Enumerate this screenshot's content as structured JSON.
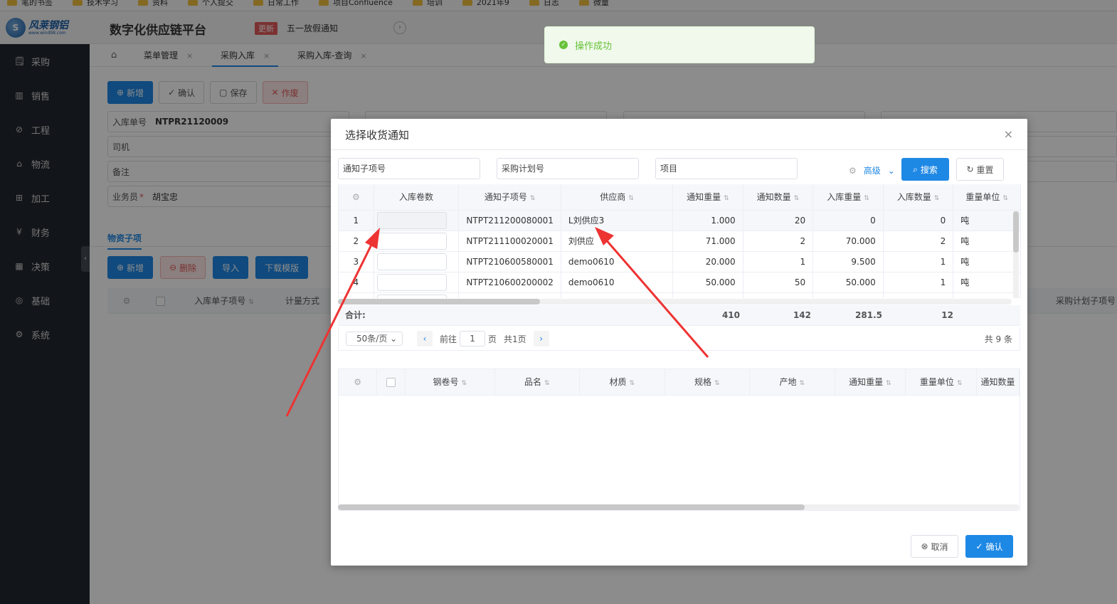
{
  "bookmarks": [
    "笔的书签",
    "技术学习",
    "资料",
    "个人提交",
    "日常工作",
    "项目Confluence",
    "培训",
    "2021年9",
    "日志",
    "",
    "微量"
  ],
  "app": {
    "title": "数字化供应链平台",
    "logo_name": "风莱钢铝",
    "logo_url": "www.wind98.com",
    "update_badge": "更新",
    "notice": "五一放假通知",
    "notice_arrow": "›"
  },
  "sidebar": {
    "items": [
      {
        "label": "采购",
        "icon": "🗒"
      },
      {
        "label": "销售",
        "icon": "▥"
      },
      {
        "label": "工程",
        "icon": "⊘"
      },
      {
        "label": "物流",
        "icon": "⌂"
      },
      {
        "label": "加工",
        "icon": "⊞"
      },
      {
        "label": "财务",
        "icon": "¥"
      },
      {
        "label": "决策",
        "icon": "▦"
      },
      {
        "label": "基础",
        "icon": "◎"
      },
      {
        "label": "系统",
        "icon": "⚙"
      }
    ],
    "collapse": "‹"
  },
  "tabs": {
    "home_icon": "⌂",
    "items": [
      {
        "label": "菜单管理",
        "close": "×"
      },
      {
        "label": "采购入库",
        "close": "×"
      },
      {
        "label": "采购入库-查询",
        "close": "×"
      }
    ]
  },
  "toolbar": {
    "new": "新增",
    "new_icon": "⊕",
    "confirm": "确认",
    "confirm_icon": "✓",
    "save": "保存",
    "save_icon": "▢",
    "void": "作废",
    "void_icon": "✕"
  },
  "form": {
    "receipt_no_label": "入库单号",
    "receipt_no": "NTPR21120009",
    "driver_label": "司机",
    "remark_label": "备注",
    "salesman_label": "业务员",
    "required_mark": "*",
    "salesman": "胡宝忠"
  },
  "section": {
    "title": "物资子项"
  },
  "sub_toolbar": {
    "new": "新增",
    "delete": "删除",
    "import": "导入",
    "download": "下载模版"
  },
  "bg_table": {
    "headers": [
      "入库单子项号",
      "计量方式",
      "采购计划子项号"
    ]
  },
  "toast": {
    "message": "操作成功",
    "icon": "✓"
  },
  "dialog": {
    "title": "选择收货通知",
    "close": "×",
    "filters": {
      "notice_item": "通知子项号",
      "plan_no": "采购计划号",
      "project": "项目"
    },
    "advanced": "高级",
    "search": "搜索",
    "search_icon": "⌕",
    "reset": "重置",
    "reset_icon": "↻",
    "upper_table": {
      "headers": [
        "入库卷数",
        "通知子项号",
        "供应商",
        "通知重量",
        "通知数量",
        "入库重量",
        "入库数量",
        "重量单位"
      ],
      "rows": [
        {
          "idx": "1",
          "notice_no": "NTPT211200080001",
          "supplier": "L刘供应3",
          "notice_weight": "1.000",
          "notice_qty": "20",
          "in_weight": "0",
          "in_qty": "0",
          "unit": "吨"
        },
        {
          "idx": "2",
          "notice_no": "NTPT211100020001",
          "supplier": "刘供应",
          "notice_weight": "71.000",
          "notice_qty": "2",
          "in_weight": "70.000",
          "in_qty": "2",
          "unit": "吨"
        },
        {
          "idx": "3",
          "notice_no": "NTPT210600580001",
          "supplier": "demo0610",
          "notice_weight": "20.000",
          "notice_qty": "1",
          "in_weight": "9.500",
          "in_qty": "1",
          "unit": "吨"
        },
        {
          "idx": "4",
          "notice_no": "NTPT210600200002",
          "supplier": "demo0610",
          "notice_weight": "50.000",
          "notice_qty": "50",
          "in_weight": "50.000",
          "in_qty": "1",
          "unit": "吨"
        }
      ],
      "summary": {
        "label": "合计:",
        "notice_weight": "410",
        "notice_qty": "142",
        "in_weight": "281.5",
        "in_qty": "12"
      }
    },
    "pager": {
      "page_size": "50条/页",
      "goto": "前往",
      "page": "1",
      "page_unit": "页",
      "total_pages": "共1页",
      "total": "共 9 条"
    },
    "lower_table": {
      "headers": [
        "钢卷号",
        "品名",
        "材质",
        "规格",
        "产地",
        "通知重量",
        "重量单位",
        "通知数量"
      ]
    },
    "cancel": "取消",
    "cancel_icon": "⊗",
    "ok": "确认",
    "ok_icon": "✓"
  },
  "colors": {
    "primary": "#1e88e5",
    "danger": "#e05a5a",
    "success": "#67c23a",
    "sidebar": "#22272e",
    "annotation": "#ee3333"
  }
}
